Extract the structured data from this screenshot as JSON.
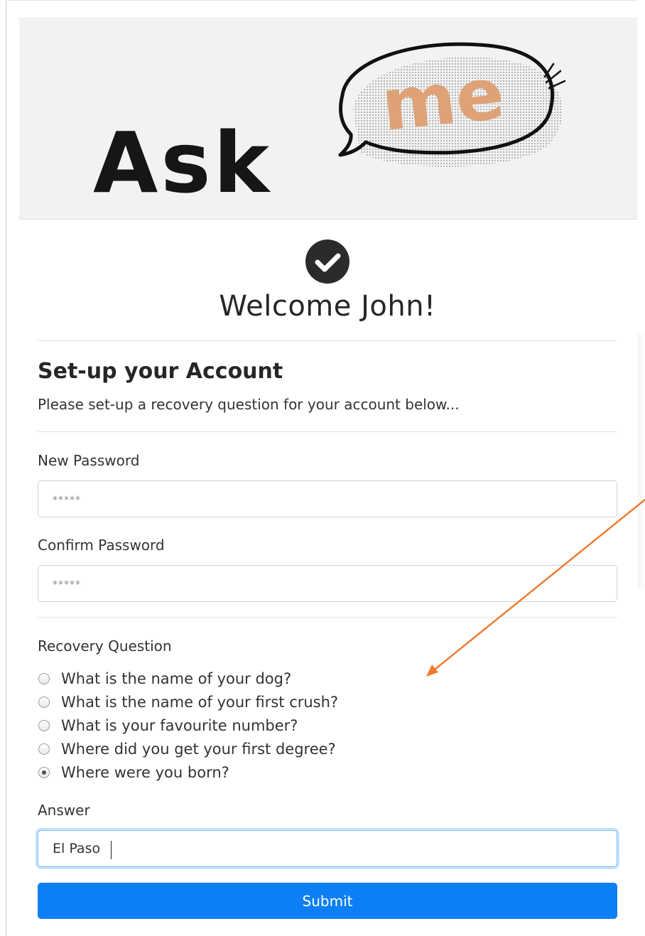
{
  "logo": {
    "word": "Ask",
    "bubble_word": "me",
    "colors": {
      "word": "#161616",
      "bubble_text": "#dea276",
      "bubble_outline": "#111111"
    }
  },
  "header": {
    "check_icon": "check-circle-icon",
    "welcome_title": "Welcome John!"
  },
  "setup": {
    "title": "Set-up your Account",
    "subtitle": "Please set-up a recovery question for your account below..."
  },
  "form": {
    "new_password": {
      "label": "New Password",
      "placeholder": "*****",
      "value": ""
    },
    "confirm_password": {
      "label": "Confirm Password",
      "placeholder": "*****",
      "value": ""
    },
    "recovery": {
      "label": "Recovery Question",
      "options": [
        {
          "label": "What is the name of your dog?",
          "selected": false
        },
        {
          "label": "What is the name of your first crush?",
          "selected": false
        },
        {
          "label": "What is your favourite number?",
          "selected": false
        },
        {
          "label": "Where did you get your first degree?",
          "selected": false
        },
        {
          "label": "Where were you born?",
          "selected": true
        }
      ]
    },
    "answer": {
      "label": "Answer",
      "value": "El Paso"
    },
    "submit_label": "Submit"
  },
  "colors": {
    "primary_button": "#0d7ff4",
    "annotation_arrow": "#f07b30"
  }
}
